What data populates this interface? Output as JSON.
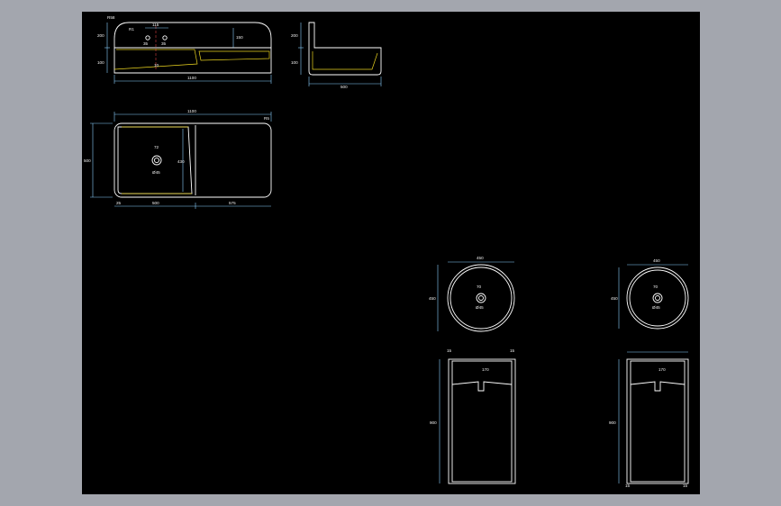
{
  "colors": {
    "background": "#a3a6ae",
    "canvas": "#000000",
    "outline": "#ffffff",
    "dimension": "#8ad0ff",
    "hatch": "#e8d21f",
    "centerline": "#ff4d4d"
  },
  "front_view": {
    "width": "1100",
    "height_upper": "200",
    "height_lower": "100",
    "spacing": "115",
    "hole_a": "35",
    "hole_b": "35",
    "radius": "R58",
    "drop": "R1",
    "depth": "150",
    "drain": "10"
  },
  "side_view": {
    "height_upper": "200",
    "height_lower": "100",
    "depth": "500"
  },
  "plan_view": {
    "width": "1100",
    "depth": "500",
    "basin_width": "500",
    "shelf_width": "575",
    "edge_left": "25",
    "inner_depth": "430",
    "drain": "72",
    "drain_label": "Ø45",
    "corner": "R5"
  },
  "pedestal_left": {
    "diameter": "450",
    "height_top": "450",
    "drain": "70",
    "drain_label": "Ø45",
    "column_height": "900",
    "base_a": "15",
    "base_b": "15",
    "bowl_depth": "170"
  },
  "pedestal_right": {
    "diameter": "450",
    "height_top": "450",
    "drain": "70",
    "drain_label": "Ø45",
    "column_height": "900",
    "base_a": "15",
    "base_b": "15",
    "bowl_depth": "170"
  }
}
